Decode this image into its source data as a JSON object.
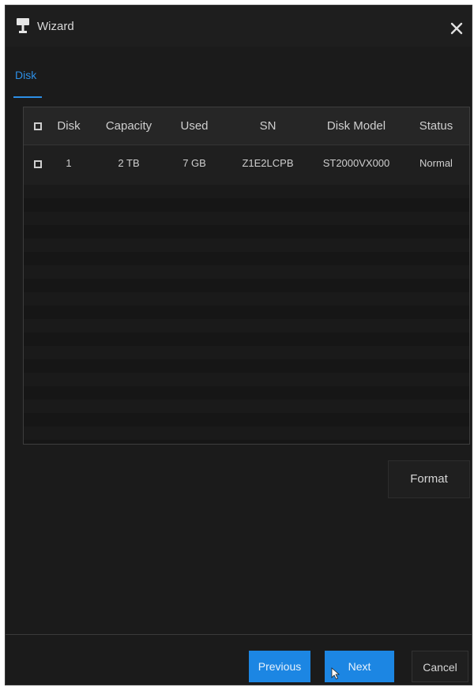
{
  "window": {
    "title": "Wizard",
    "close_icon": "close-icon"
  },
  "tabs": [
    {
      "label": "Disk",
      "active": true
    }
  ],
  "table": {
    "columns": [
      "Disk",
      "Capacity",
      "Used",
      "SN",
      "Disk Model",
      "Status"
    ],
    "rows": [
      {
        "checked": false,
        "disk": "1",
        "capacity": "2 TB",
        "used": "7 GB",
        "sn": "Z1E2LCPB",
        "disk_model": "ST2000VX000",
        "status": "Normal"
      }
    ]
  },
  "actions": {
    "format_label": "Format"
  },
  "footer": {
    "previous_label": "Previous",
    "next_label": "Next",
    "cancel_label": "Cancel"
  },
  "colors": {
    "accent": "#1c86e3",
    "background": "#1b1b1b",
    "text": "#d2d2d2"
  }
}
